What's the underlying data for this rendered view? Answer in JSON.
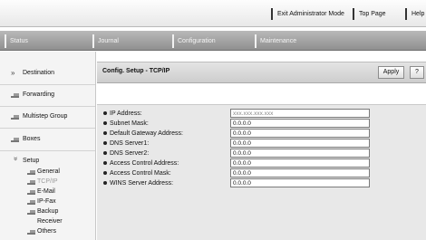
{
  "top_links": {
    "exit_admin": "Exit Administrator Mode",
    "top_page": "Top Page",
    "help": "Help"
  },
  "tabs": {
    "status": "Status",
    "journal": "Journal",
    "configuration": "Configuration",
    "maintenance": "Maintenance"
  },
  "sidebar": {
    "destination": "Destination",
    "forwarding": "Forwarding",
    "multistep_group": "Multistep Group",
    "boxes": "Boxes",
    "setup": "Setup",
    "setup_items": {
      "general": "General",
      "tcpip": "TCP/IP",
      "email": "E-Mail",
      "ipfax": "IP-Fax",
      "backup_receiver_1": "Backup",
      "backup_receiver_2": "Receiver",
      "others": "Others"
    }
  },
  "main": {
    "title": "Config. Setup - TCP/IP",
    "apply_label": "Apply",
    "help_label": "?",
    "fields": {
      "ip_address": {
        "label": "IP Address:",
        "placeholder": "xxx.xxx.xxx.xxx"
      },
      "subnet_mask": {
        "label": "Subnet Mask:",
        "value": "0.0.0.0"
      },
      "default_gateway": {
        "label": "Default Gateway Address:",
        "value": "0.0.0.0"
      },
      "dns1": {
        "label": "DNS Server1:",
        "value": "0.0.0.0"
      },
      "dns2": {
        "label": "DNS Server2:",
        "value": "0.0.0.0"
      },
      "access_control_address": {
        "label": "Access Control Address:",
        "value": "0.0.0.0"
      },
      "access_control_mask": {
        "label": "Access Control Mask:",
        "value": "0.0.0.0"
      },
      "wins_server": {
        "label": "WINS Server Address:",
        "value": "0.0.0.0"
      }
    }
  }
}
